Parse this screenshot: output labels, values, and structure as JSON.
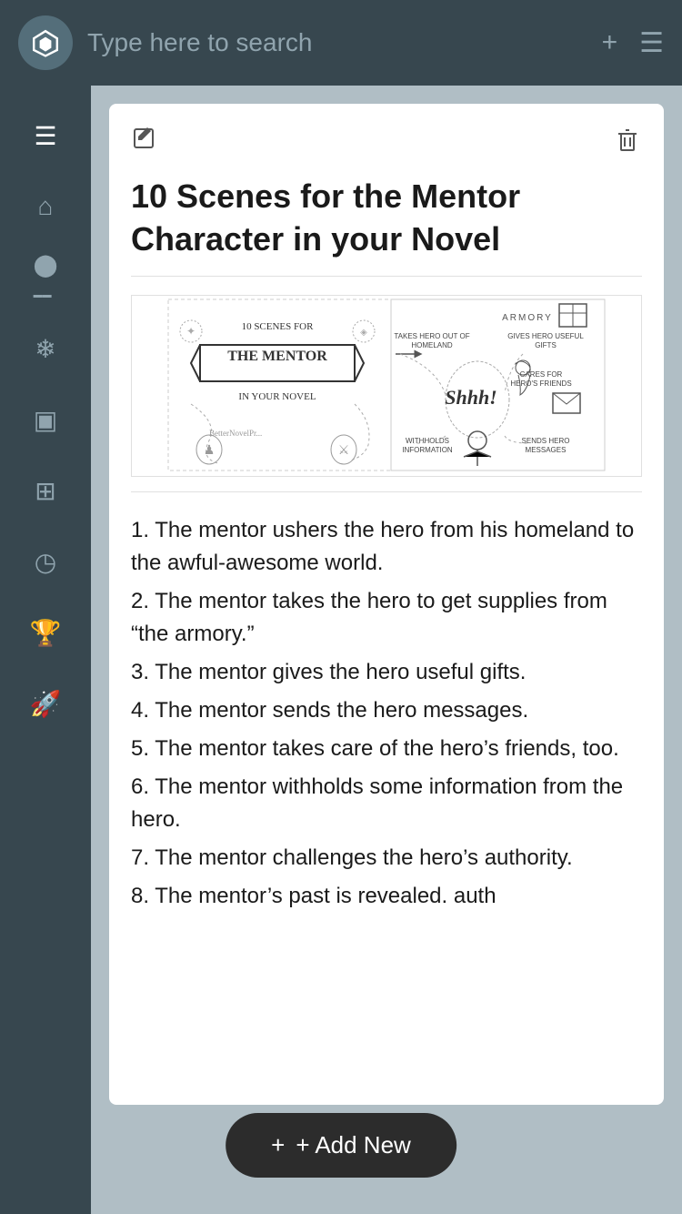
{
  "header": {
    "search_placeholder": "Type here to search",
    "add_icon": "+",
    "menu_icon": "☰"
  },
  "sidebar": {
    "items": [
      {
        "id": "menu",
        "icon": "☰",
        "label": "Menu"
      },
      {
        "id": "home",
        "icon": "⌂",
        "label": "Home"
      },
      {
        "id": "database",
        "icon": "⊕",
        "label": "Database"
      },
      {
        "id": "snowflake",
        "icon": "❄",
        "label": "Snowflake"
      },
      {
        "id": "columns",
        "icon": "▣",
        "label": "Columns"
      },
      {
        "id": "grid",
        "icon": "⊞",
        "label": "Grid"
      },
      {
        "id": "history",
        "icon": "◷",
        "label": "History"
      },
      {
        "id": "trophy",
        "icon": "🏆",
        "label": "Trophy"
      },
      {
        "id": "rocket",
        "icon": "🚀",
        "label": "Rocket"
      }
    ]
  },
  "note": {
    "title": "10 Scenes for the Mentor Character in your Novel",
    "edit_icon": "✎",
    "delete_icon": "🗑",
    "image_alt": "10 Scenes for the Mentor in Your Novel illustration",
    "content_items": [
      "1. The mentor ushers the hero from his homeland to the awful-awesome world.",
      "2. The mentor takes the hero to get supplies from “the armory.”",
      "3. The mentor gives the hero useful gifts.",
      "4. The mentor sends the hero messages.",
      "5. The mentor takes care of the hero’s friends, too.",
      "6. The mentor withholds some information from the hero.",
      "7. The mentor challenges the hero’s authority.",
      "8. The mentor’s past is revealed."
    ]
  },
  "add_new_bar": {
    "label": "+ Add New"
  }
}
